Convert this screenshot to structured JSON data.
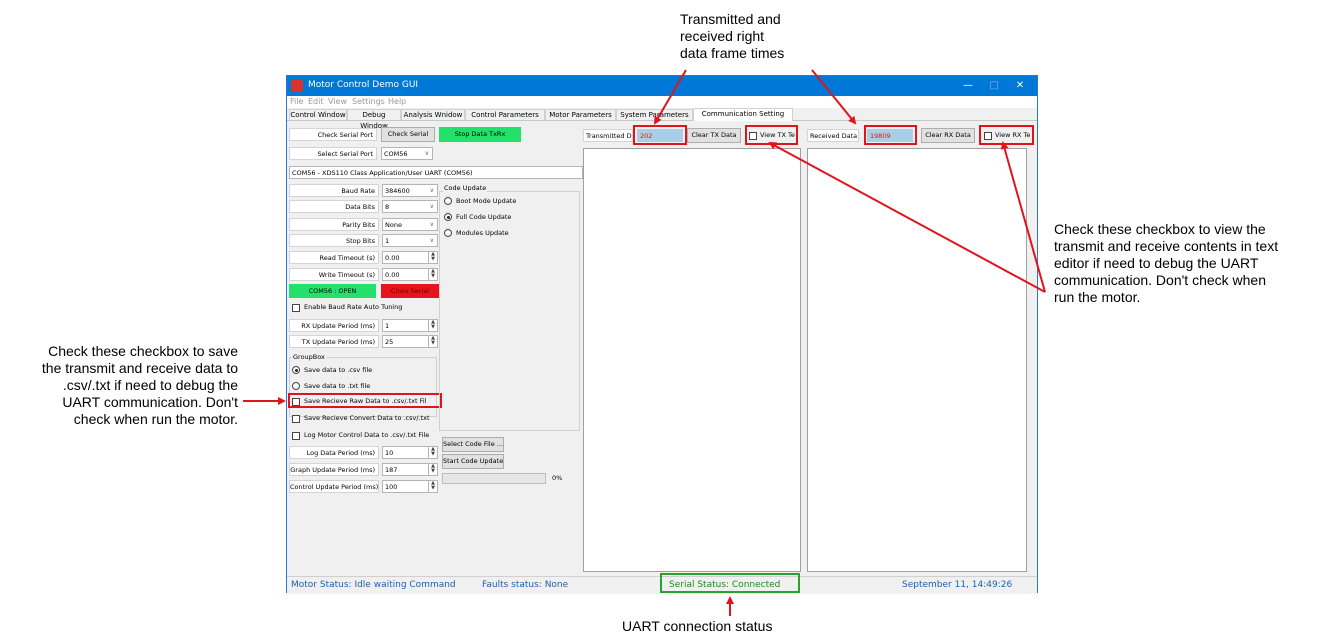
{
  "annotations": {
    "top_callout": [
      "Transmitted and",
      "received right",
      "data frame times"
    ],
    "right_callout": [
      "Check these checkbox to view the",
      "transmit and receive contents in text",
      "editor if need to debug the UART",
      "communication. Don't check when",
      "run the motor."
    ],
    "left_callout": [
      "Check these checkbox to save",
      "the transmit and receive data to",
      ".csv/.txt if need to debug the",
      "UART communication. Don't",
      "check when run the motor."
    ],
    "bottom_callout": "UART connection status",
    "arrow_color": "#e0141b"
  },
  "window": {
    "title": "Motor Control Demo GUI",
    "controls": [
      "—",
      "□",
      "✕"
    ],
    "menu": [
      "File",
      "Edit",
      "View",
      "Settings",
      "Help"
    ],
    "tabs": [
      "Control Window",
      "Debug Window",
      "Analysis Wnidow",
      "Control Parameters",
      "Motor Parameters",
      "System Parameters",
      "Communication Setting"
    ],
    "active_tab": "Communication Setting"
  },
  "serial": {
    "check_port_label": "Check Serial Port",
    "check_serial_button": "Check Serial",
    "stop_button": "Stop Data TxRx",
    "select_port_label": "Select Serial Port",
    "port_value": "COM56",
    "port_description": "COM56 - XDS110 Class Application/User UART (COM56)",
    "baud_label": "Baud Rate",
    "baud_value": "384600",
    "databits_label": "Data Bits",
    "databits_value": "8",
    "parity_label": "Parity Bits",
    "parity_value": "None",
    "stopbits_label": "Stop Bits",
    "stopbits_value": "1",
    "read_timeout_label": "Read Timeout (s)",
    "read_timeout_value": "0.00",
    "write_timeout_label": "Write Timeout (s)",
    "write_timeout_value": "0.00",
    "open_status": "COM56 : OPEN",
    "close_button": "Close Serial",
    "auto_tuning_label": "Enable Baud Rate Auto Tuning",
    "rx_period_label": "RX Update Period (ms)",
    "rx_period_value": "1",
    "tx_period_label": "TX Update Period (ms)",
    "tx_period_value": "25"
  },
  "code_update": {
    "title": "Code Update",
    "options": [
      "Boot Mode Update",
      "Full Code Update",
      "Modules Update"
    ],
    "selected": "Full Code Update",
    "select_file_button": "Select Code File ...",
    "start_button": "Start Code Update",
    "progress_text": "0%",
    "progress": 0
  },
  "group_box": {
    "title": "GroupBox",
    "options": [
      "Save data to .csv file",
      "Save data to .txt file"
    ],
    "selected": "Save data to .csv file",
    "save_raw_label": "Save Recieve Raw Data to .csv/.txt Fil",
    "save_convert_label": "Save Recieve Convert Data to .csv/.txt",
    "log_motor_label": "Log Motor Control Data to .csv/.txt File",
    "log_period_label": "Log Data Period (ms)",
    "log_period_value": "10",
    "graph_period_label": "Graph Update Period (ms)",
    "graph_period_value": "187",
    "control_period_label": "Control Update Period (ms)",
    "control_period_value": "100"
  },
  "tx": {
    "label": "Transmitted Da",
    "value": "202",
    "clear_button": "Clear TX Data",
    "view_label": "View TX Te"
  },
  "rx": {
    "label": "Received Data",
    "value": "19809",
    "clear_button": "Clear RX Data",
    "view_label": "View RX Te"
  },
  "status_bar": {
    "motor": "Motor Status: Idle waiting Command",
    "faults": "Faults status: None",
    "serial": "Serial Status: Connected",
    "datetime": "September 11, 14:49:26"
  },
  "colors": {
    "green": "#22e06c",
    "red": "#e8141b",
    "title_blue": "#0078d7",
    "status_text": "#1e5fb4",
    "serial_status": "#1a8c1a",
    "value_red": "#e0141b",
    "value_bg": "#a9cfe6"
  }
}
